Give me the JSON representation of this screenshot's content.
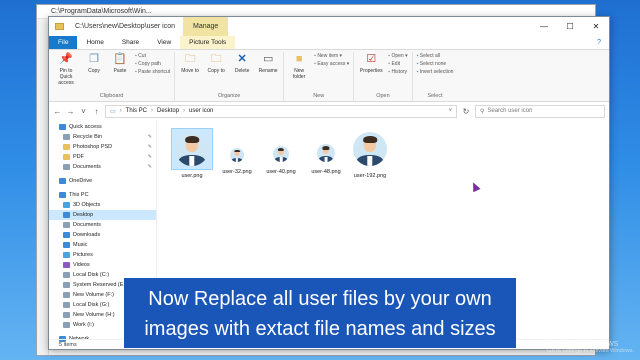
{
  "background_window": {
    "path": "C:\\ProgramData\\Microsoft\\Win...",
    "manage_label": "Manage"
  },
  "window": {
    "path": "C:\\Users\\new\\Desktop\\user icon",
    "manage_label": "Manage",
    "controls": {
      "minimize": "—",
      "maximize": "☐",
      "close": "✕"
    }
  },
  "tabs": [
    {
      "label": "File"
    },
    {
      "label": "Home"
    },
    {
      "label": "Share"
    },
    {
      "label": "View"
    },
    {
      "label": "Picture Tools"
    }
  ],
  "ribbon": {
    "clipboard": {
      "label": "Clipboard",
      "pin": "Pin to Quick access",
      "copy": "Copy",
      "paste": "Paste",
      "cut": "Cut",
      "copy_path": "Copy path",
      "paste_shortcut": "Paste shortcut"
    },
    "organize": {
      "label": "Organize",
      "move_to": "Move to",
      "copy_to": "Copy to",
      "delete": "Delete",
      "rename": "Rename"
    },
    "new": {
      "label": "New",
      "new_folder": "New folder",
      "new_item": "New item ▾",
      "easy_access": "Easy access ▾"
    },
    "open": {
      "label": "Open",
      "properties": "Properties",
      "open": "Open ▾",
      "edit": "Edit",
      "history": "History"
    },
    "select": {
      "label": "Select",
      "select_all": "Select all",
      "select_none": "Select none",
      "invert_selection": "Invert selection"
    }
  },
  "address": {
    "crumbs": [
      "This PC",
      "Desktop",
      "user icon"
    ],
    "search_placeholder": "Search user icon"
  },
  "navpane": {
    "items": [
      {
        "label": "Quick access",
        "color": "#3c8ad8"
      },
      {
        "label": "Recycle Bin",
        "color": "#8aa1b5",
        "indent": true,
        "pin": "✎"
      },
      {
        "label": "Photoshop PSD",
        "color": "#e8c15a",
        "indent": true,
        "pin": "✎"
      },
      {
        "label": "PDF",
        "color": "#e8c15a",
        "indent": true,
        "pin": "✎"
      },
      {
        "label": "Documents",
        "color": "#8aa1b5",
        "indent": true,
        "pin": "✎"
      },
      {
        "label": "OneDrive",
        "color": "#3c8ad8"
      },
      {
        "label": "This PC",
        "color": "#3c8ad8"
      },
      {
        "label": "3D Objects",
        "color": "#4aa3df",
        "indent": true
      },
      {
        "label": "Desktop",
        "color": "#3c8ad8",
        "indent": true,
        "selected": true
      },
      {
        "label": "Documents",
        "color": "#8aa1b5",
        "indent": true
      },
      {
        "label": "Downloads",
        "color": "#3c8ad8",
        "indent": true
      },
      {
        "label": "Music",
        "color": "#3c8ad8",
        "indent": true
      },
      {
        "label": "Pictures",
        "color": "#4aa3df",
        "indent": true
      },
      {
        "label": "Videos",
        "color": "#8a5cc0",
        "indent": true
      },
      {
        "label": "Local Disk (C:)",
        "color": "#8aa1b5",
        "indent": true
      },
      {
        "label": "System Reserved (E:)",
        "color": "#8aa1b5",
        "indent": true
      },
      {
        "label": "New Volume (F:)",
        "color": "#8aa1b5",
        "indent": true
      },
      {
        "label": "Local Disk (G:)",
        "color": "#8aa1b5",
        "indent": true
      },
      {
        "label": "New Volume (H:)",
        "color": "#8aa1b5",
        "indent": true
      },
      {
        "label": "Work (I:)",
        "color": "#8aa1b5",
        "indent": true
      },
      {
        "label": "Network",
        "color": "#3c8ad8"
      }
    ]
  },
  "files": [
    {
      "name": "user.png",
      "size": "big",
      "selected": true
    },
    {
      "name": "user-32.png",
      "size": "small"
    },
    {
      "name": "user-40.png",
      "size": "small"
    },
    {
      "name": "user-48.png",
      "size": "small"
    },
    {
      "name": "user-192.png",
      "size": "big"
    }
  ],
  "status": {
    "items_count": "5 items"
  },
  "caption": {
    "line1": "Now Replace all user files by your own",
    "line2": "images with extact file names and sizes"
  },
  "watermark": {
    "line1": "Activate Windows",
    "line2": "Go to Settings to activate Windows."
  },
  "colors": {
    "accent": "#1979ca",
    "caption_bg": "#1a56b8",
    "selection": "#cce8ff"
  }
}
